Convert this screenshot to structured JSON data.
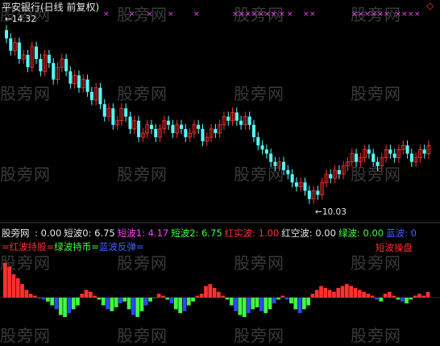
{
  "header": {
    "title": "平安银行(日线 前复权)"
  },
  "watermark": "股旁网",
  "annotations": {
    "high_label": "14.32",
    "low_label": "10.03"
  },
  "indicator_legend": {
    "name": "股旁网",
    "items": [
      {
        "label": " : 0.00",
        "color": "#e6e6e6"
      },
      {
        "label": "短波0: 6.75",
        "color": "#e6e6e6"
      },
      {
        "label": "短波1: 4.17",
        "color": "#ff40ff"
      },
      {
        "label": "短波2: 6.75",
        "color": "#40ff40"
      },
      {
        "label": "红实波: 1.00",
        "color": "#ff3030"
      },
      {
        "label": "红空波: 0.00",
        "color": "#e6e6e6"
      },
      {
        "label": "绿波: 0.00",
        "color": "#40ff40"
      },
      {
        "label": "蓝波: 0",
        "color": "#4060ff"
      }
    ],
    "subrow": [
      {
        "label": "=红波持股=",
        "color": "#ff3030"
      },
      {
        "label": "绿波持币=",
        "color": "#40ff40"
      },
      {
        "label": "蓝波反弹=",
        "color": "#4060ff"
      }
    ],
    "right_label": "短波操盘"
  },
  "colors": {
    "up": "#ff3030",
    "down": "#54ffff",
    "marker": "#ff40ff",
    "red_wave": "#ff3030",
    "green_wave": "#40ff40",
    "blue_wave": "#3048ff"
  },
  "chart_data": [
    {
      "type": "candlestick",
      "title": "平安银行(日线 前复权)",
      "annotations": [
        {
          "text": "14.32",
          "type": "high"
        },
        {
          "text": "10.03",
          "type": "low"
        }
      ],
      "ylim": [
        9.8,
        14.5
      ],
      "close": [
        14.0,
        13.7,
        13.9,
        13.5,
        13.6,
        13.3,
        13.8,
        13.5,
        13.2,
        13.6,
        13.4,
        13.0,
        13.3,
        13.5,
        13.2,
        12.9,
        13.1,
        12.8,
        13.0,
        12.7,
        12.5,
        12.8,
        12.4,
        12.1,
        12.3,
        11.9,
        12.0,
        12.3,
        12.1,
        11.8,
        12.0,
        11.6,
        11.7,
        11.9,
        11.8,
        11.6,
        11.8,
        12.0,
        11.9,
        11.7,
        11.9,
        11.8,
        11.6,
        11.7,
        11.9,
        11.8,
        11.5,
        11.6,
        11.8,
        11.7,
        11.9,
        12.1,
        12.0,
        12.2,
        12.0,
        11.9,
        12.1,
        11.9,
        11.6,
        11.4,
        11.3,
        11.2,
        11.0,
        10.9,
        11.0,
        10.8,
        10.7,
        10.5,
        10.4,
        10.5,
        10.3,
        10.1,
        10.3,
        10.2,
        10.5,
        10.7,
        10.6,
        10.8,
        10.7,
        10.9,
        11.0,
        11.2,
        11.0,
        11.1,
        11.3,
        11.2,
        11.0,
        10.9,
        11.1,
        11.3,
        11.2,
        11.1,
        11.3,
        11.4,
        11.2,
        11.0,
        11.1,
        11.3,
        11.2,
        11.4
      ]
    },
    {
      "type": "bar",
      "title": "股旁网",
      "description_values": "oscillator histogram",
      "values": [
        0.9,
        0.8,
        0.6,
        0.5,
        0.35,
        0.2,
        0.1,
        0.05,
        0,
        -0.05,
        -0.1,
        -0.2,
        -0.3,
        -0.45,
        -0.5,
        -0.4,
        -0.3,
        -0.2,
        0.1,
        0.2,
        0.15,
        0.05,
        -0.05,
        -0.2,
        -0.3,
        -0.35,
        -0.25,
        -0.15,
        -0.1,
        -0.3,
        -0.45,
        -0.5,
        -0.35,
        -0.2,
        -0.1,
        0,
        0.1,
        0.05,
        -0.05,
        -0.15,
        -0.3,
        -0.4,
        -0.35,
        -0.2,
        -0.1,
        0.05,
        0.1,
        0.3,
        0.35,
        0.25,
        0.15,
        0.05,
        -0.05,
        -0.2,
        -0.35,
        -0.45,
        -0.5,
        -0.4,
        -0.3,
        -0.25,
        -0.35,
        -0.4,
        -0.3,
        -0.15,
        -0.05,
        0.05,
        -0.05,
        -0.15,
        -0.3,
        -0.4,
        -0.3,
        -0.2,
        0.1,
        0.2,
        0.3,
        0.25,
        0.2,
        0.15,
        0.25,
        0.3,
        0.35,
        0.3,
        0.25,
        0.2,
        0.15,
        0.1,
        0.05,
        -0.05,
        -0.1,
        0.1,
        0.15,
        0.05,
        -0.05,
        -0.1,
        -0.15,
        -0.05,
        0.05,
        0.1,
        0.05,
        0.15
      ]
    }
  ]
}
